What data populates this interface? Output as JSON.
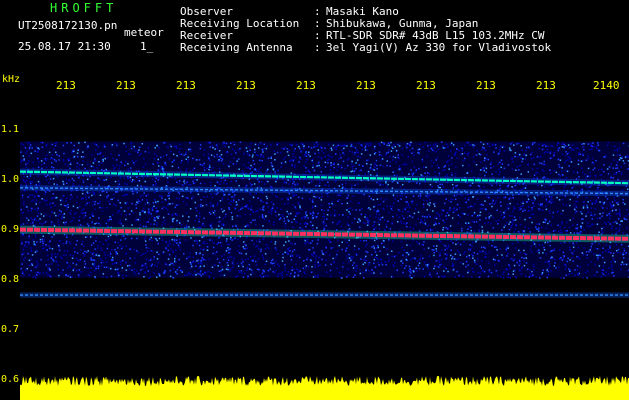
{
  "header": {
    "logo": "HROFFT",
    "filename": "UT2508172130.pn",
    "mode": "meteor",
    "datetime": "25.08.17 21:30",
    "flag": "1_"
  },
  "info": [
    {
      "label": "Observer",
      "value": "Masaki Kano"
    },
    {
      "label": "Receiving Location",
      "value": "Shibukawa, Gunma, Japan"
    },
    {
      "label": "Receiver",
      "value": "RTL-SDR SDR# 43dB L15 103.2MHz CW"
    },
    {
      "label": "Receiving Antenna",
      "value": "3el Yagi(V) Az 330 for Vladivostok"
    }
  ],
  "chart_data": {
    "type": "heatmap",
    "x_unit": "",
    "x_ticks": [
      "213",
      "213",
      "213",
      "213",
      "213",
      "213",
      "213",
      "213",
      "213",
      "2140"
    ],
    "y_unit": "kHz",
    "y_ticks": [
      "1.1",
      "1.0",
      "0.9",
      "0.8",
      "0.7",
      "0.6"
    ],
    "ylim": [
      0.6,
      1.1
    ],
    "signal_bands_khz": [
      {
        "y_start": 0.868,
        "y_end": 0.852,
        "strength": "strong"
      },
      {
        "y_start": 0.968,
        "y_end": 0.948,
        "strength": "medium"
      },
      {
        "y_start": 0.94,
        "y_end": 0.93,
        "strength": "weak"
      },
      {
        "y_start": 0.755,
        "y_end": 0.755,
        "strength": "weak"
      }
    ],
    "noise_band_khz": [
      0.785,
      1.02
    ],
    "colors": {
      "background": "#000000",
      "noise": "#0000b0",
      "strong_signal": "#ff3060",
      "secondary": "#00ffc0",
      "label": "#ffff00",
      "power_trace": "#ffff00"
    }
  }
}
